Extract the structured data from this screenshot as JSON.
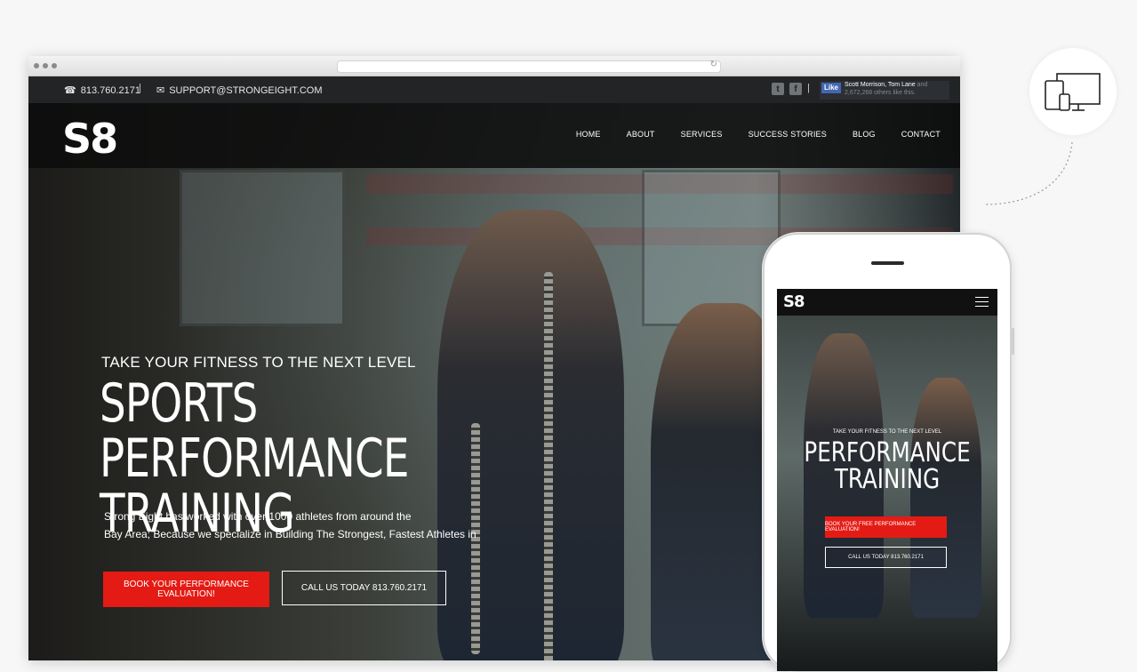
{
  "topbar": {
    "phone": "813.760.2171",
    "separator": "|",
    "email": "SUPPORT@STRONGEIGHT.COM",
    "social": [
      "twitter-icon",
      "facebook-icon"
    ],
    "fb_like_label": "Like",
    "fb_names": "Scott Morrison, Tom Lane",
    "fb_and": "and",
    "fb_count": "2,672,268 others like this."
  },
  "brand": {
    "logo": "S8"
  },
  "nav": {
    "items": [
      "HOME",
      "ABOUT",
      "SERVICES",
      "SUCCESS STORIES",
      "BLOG",
      "CONTACT"
    ]
  },
  "hero": {
    "kicker": "TAKE YOUR FITNESS TO THE NEXT LEVEL",
    "headline_line1": "SPORTS PERFORMANCE",
    "headline_line2": "TRAINING",
    "subtext_line1": "Strong Eight has worked with over 1000 athletes from around the",
    "subtext_line2": "Bay Area; Because we specialize in Building The Strongest, Fastest Athletes in",
    "cta_primary": "BOOK YOUR PERFORMANCE EVALUATION!",
    "cta_secondary": "CALL US TODAY 813.760.2171"
  },
  "mobile": {
    "logo": "S8",
    "kicker": "TAKE YOUR FITNESS TO THE NEXT LEVEL",
    "title_line1": "PERFORMANCE",
    "title_line2": "TRAINING",
    "cta_primary": "BOOK YOUR FREE PERFORMANCE EVALUATION!",
    "cta_secondary": "CALL US TODAY 813.760.2171"
  },
  "colors": {
    "accent_red": "#e41b14",
    "topbar_bg": "#222426",
    "nav_bg": "#0c0c0c"
  }
}
